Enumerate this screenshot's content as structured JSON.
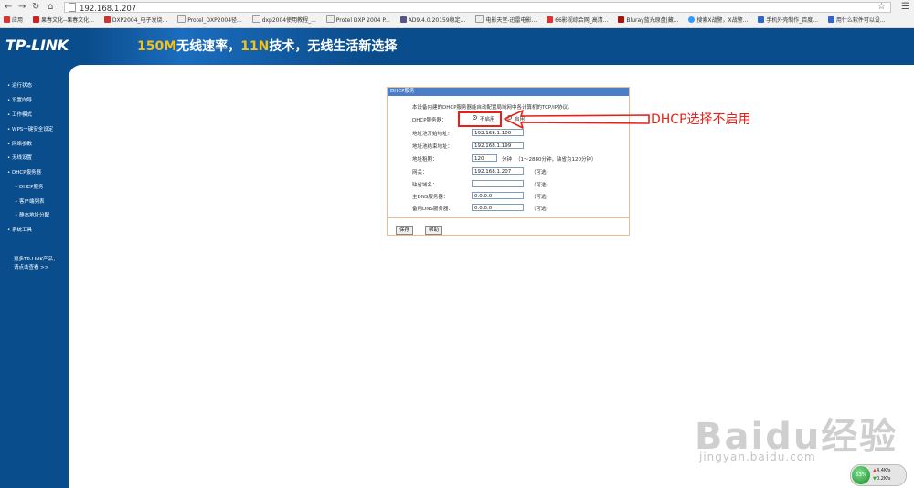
{
  "browser": {
    "url": "192.168.1.207",
    "bookmarks": [
      "应用",
      "果春文化--果春文化...",
      "DXP2004_电子发烧...",
      "Protel_DXP2004径...",
      "dxp2004使用教程_...",
      "Protel DXP 2004 P...",
      "AD9.4.0.20159稳定...",
      "电影天堂-迅雷电影...",
      "66影视综合网_高清...",
      "Bluray蓝光原盘|藏...",
      "搜索X战警，X战警...",
      "手机外壳制作_百度...",
      "用什么软件可以设..."
    ]
  },
  "header": {
    "logo": "TP-LINK",
    "slogan_a": "150M",
    "slogan_b": "无线速率，",
    "slogan_c": "11N",
    "slogan_d": "技术，无线生活新选择"
  },
  "menu": {
    "items": [
      "运行状态",
      "设置向导",
      "工作模式",
      "WPS一键安全设定",
      "网络参数",
      "无线设置",
      "DHCP服务器",
      "DHCP服务",
      "客户端列表",
      "静态地址分配",
      "系统工具"
    ],
    "more_line1": "更多TP-LINK产品，",
    "more_line2": "请点击查看 >>"
  },
  "form": {
    "title": "DHCP服务",
    "intro": "本设备内建的DHCP服务器能自动配置局域网中各计算机的TCP/IP协议。",
    "server_label": "DHCP服务器：",
    "radio_off": "不启用",
    "radio_on": "启用",
    "start_label": "地址池开始地址：",
    "start_value": "192.168.1.100",
    "end_label": "地址池结束地址：",
    "end_value": "192.168.1.199",
    "lease_label": "地址租期：",
    "lease_value": "120",
    "lease_unit": "分钟",
    "lease_note": "（1～2880分钟，缺省为120分钟）",
    "gateway_label": "网关：",
    "gateway_value": "192.168.1.207",
    "optional": "（可选）",
    "domain_label": "缺省域名：",
    "domain_value": "",
    "dns1_label": "主DNS服务器：",
    "dns1_value": "0.0.0.0",
    "dns2_label": "备用DNS服务器：",
    "dns2_value": "0.0.0.0",
    "save": "保存",
    "help": "帮助"
  },
  "annotation": {
    "text": "DHCP选择不启用",
    "color": "#e8201a"
  },
  "watermark": {
    "brand": "Baidu经验",
    "url": "jingyan.baidu.com"
  },
  "netmeter": {
    "percent": "53%",
    "up": "4.4K/s",
    "down": "0.2K/s"
  },
  "colors": {
    "router_blue": "#0a4d8c",
    "panel_border": "#f2b78a",
    "title_bar": "#4a7fc8"
  }
}
